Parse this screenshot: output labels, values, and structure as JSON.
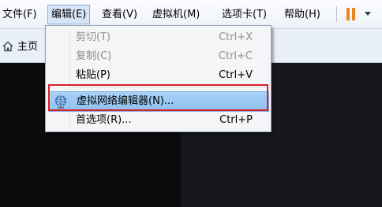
{
  "menubar": {
    "items": [
      {
        "label": "文件(F)"
      },
      {
        "label": "编辑(E)"
      },
      {
        "label": "查看(V)"
      },
      {
        "label": "虚拟机(M)"
      },
      {
        "label": "选项卡(T)"
      },
      {
        "label": "帮助(H)"
      }
    ],
    "active_index": 1,
    "pause_icon": "pause-icon",
    "pause_color": "#e8871e"
  },
  "tabs": {
    "home_label": "主页",
    "home_icon": "home-icon"
  },
  "edit_menu": {
    "items": [
      {
        "label": "剪切(T)",
        "shortcut": "Ctrl+X",
        "enabled": false
      },
      {
        "label": "复制(C)",
        "shortcut": "Ctrl+C",
        "enabled": false
      },
      {
        "label": "粘贴(P)",
        "shortcut": "Ctrl+V",
        "enabled": true
      },
      {
        "label": "虚拟网络编辑器(N)...",
        "shortcut": "",
        "enabled": true,
        "highlighted": true,
        "icon": "globe-network-icon"
      },
      {
        "label": "首选项(R)...",
        "shortcut": "Ctrl+P",
        "enabled": true
      }
    ]
  },
  "annotation": {
    "color": "#d8202a",
    "target": "虚拟网络编辑器(N)..."
  }
}
